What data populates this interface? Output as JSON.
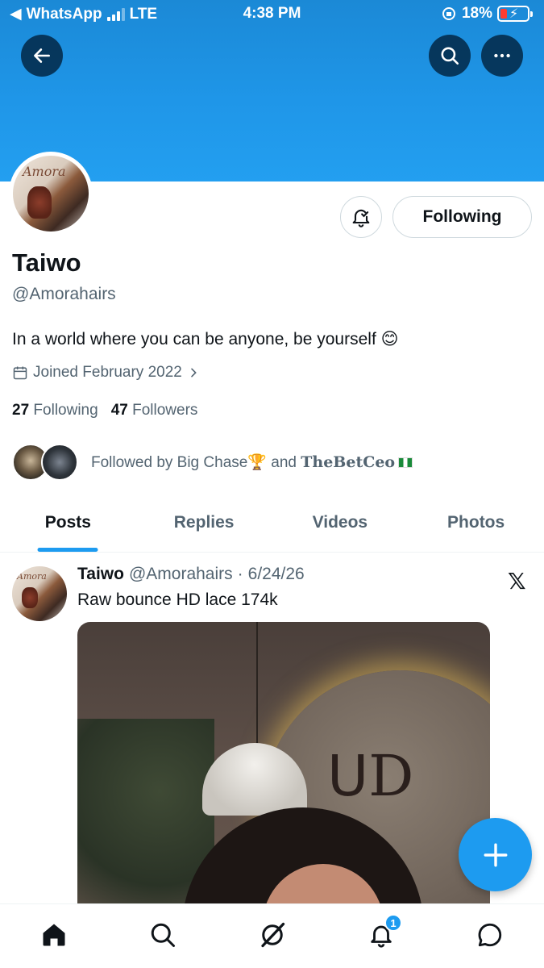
{
  "status_bar": {
    "back_app": "WhatsApp",
    "network": "LTE",
    "time": "4:38 PM",
    "battery": "18%"
  },
  "profile": {
    "name": "Taiwo",
    "handle": "@Amorahairs",
    "bio": "In a world where you can be anyone, be yourself 😊",
    "joined": "Joined February 2022",
    "following_count": "27",
    "following_label": "Following",
    "followers_count": "47",
    "followers_label": "Followers",
    "follow_button": "Following",
    "avatar_logo": "Amora"
  },
  "followed_by": {
    "prefix": "Followed by Big Chase🏆 and ",
    "name2": "TheBetCeo"
  },
  "tabs": [
    {
      "label": "Posts",
      "active": true
    },
    {
      "label": "Replies",
      "active": false
    },
    {
      "label": "Videos",
      "active": false
    },
    {
      "label": "Photos",
      "active": false
    }
  ],
  "post": {
    "name": "Taiwo",
    "handle": "@Amorahairs",
    "date": "6/24/26",
    "text": "Raw bounce HD lace 174k",
    "source_icon": "x-logo-icon"
  },
  "nav": {
    "notifications_badge": "1"
  },
  "colors": {
    "accent": "#1d9bf0",
    "banner": "#1f96e8",
    "muted": "#536471"
  }
}
